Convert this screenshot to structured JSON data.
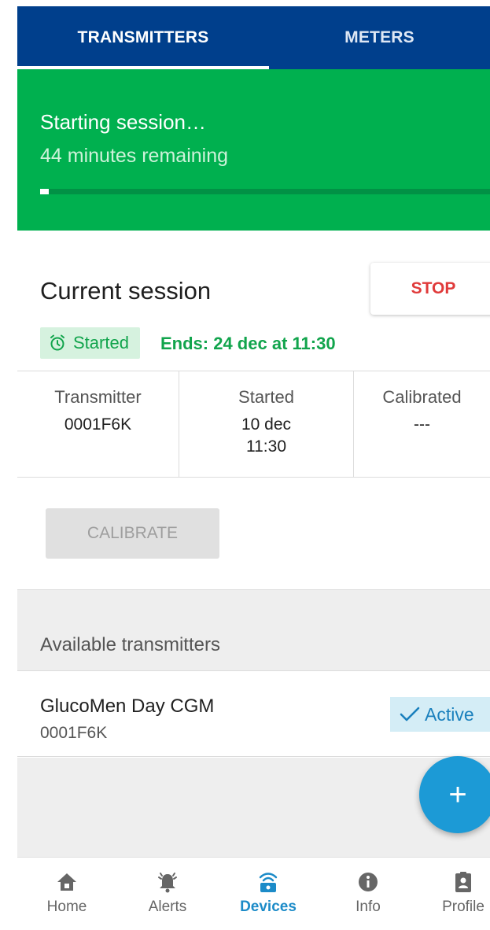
{
  "tabs": [
    {
      "label": "TRANSMITTERS",
      "selected": true
    },
    {
      "label": "METERS",
      "selected": false
    }
  ],
  "session_banner": {
    "title": "Starting session…",
    "subtitle": "44 minutes remaining",
    "progress_fraction": 0.02
  },
  "current_session": {
    "title": "Current session",
    "stop_label": "STOP",
    "status_badge": "Started",
    "ends_text": "Ends: 24 dec at 11:30",
    "columns": [
      {
        "label": "Transmitter",
        "value_line1": "0001F6K",
        "value_line2": ""
      },
      {
        "label": "Started",
        "value_line1": "10 dec",
        "value_line2": "11:30"
      },
      {
        "label": "Calibrated",
        "value_line1": "---",
        "value_line2": ""
      }
    ],
    "calibrate_label": "CALIBRATE"
  },
  "available": {
    "header": "Available transmitters",
    "devices": [
      {
        "name": "GlucoMen Day CGM",
        "id": "0001F6K",
        "status": "Active"
      }
    ]
  },
  "fab": {
    "icon": "plus-icon",
    "label": "+"
  },
  "bottom_nav": [
    {
      "label": "Home",
      "icon": "home-icon",
      "selected": false
    },
    {
      "label": "Alerts",
      "icon": "bell-icon",
      "selected": false
    },
    {
      "label": "Devices",
      "icon": "transmitter-icon",
      "selected": true
    },
    {
      "label": "Info",
      "icon": "info-icon",
      "selected": false
    },
    {
      "label": "Profile",
      "icon": "profile-badge-icon",
      "selected": false
    }
  ],
  "colors": {
    "tab_bar": "#003f8c",
    "banner_green": "#00b04f",
    "stop_red": "#e03a3a",
    "status_green": "#11a44c",
    "accent_blue": "#1c9ad6"
  }
}
